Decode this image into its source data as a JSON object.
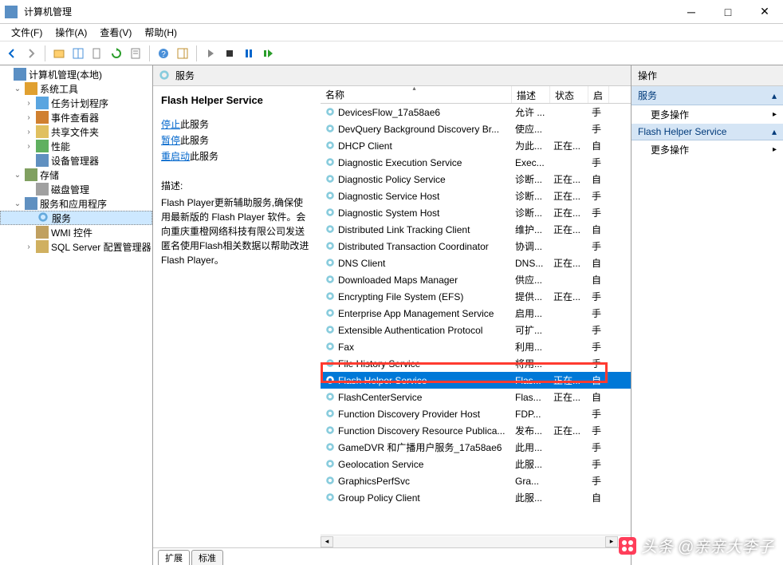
{
  "window": {
    "title": "计算机管理"
  },
  "menu": {
    "file": "文件(F)",
    "action": "操作(A)",
    "view": "查看(V)",
    "help": "帮助(H)"
  },
  "tree": {
    "root": "计算机管理(本地)",
    "sys_tools": "系统工具",
    "task_sched": "任务计划程序",
    "event_viewer": "事件查看器",
    "shared": "共享文件夹",
    "perf": "性能",
    "devmgr": "设备管理器",
    "storage": "存储",
    "diskmgr": "磁盘管理",
    "svc_apps": "服务和应用程序",
    "services": "服务",
    "wmi": "WMI 控件",
    "sql": "SQL Server 配置管理器"
  },
  "mid": {
    "header": "服务",
    "svc_name": "Flash Helper Service",
    "stop": "停止",
    "stop_suffix": "此服务",
    "pause": "暂停",
    "pause_suffix": "此服务",
    "restart": "重启动",
    "restart_suffix": "此服务",
    "desc_label": "描述:",
    "desc_text": "Flash Player更新辅助服务,确保使用最新版的 Flash Player 软件。会向重庆重橙网络科技有限公司发送匿名使用Flash相关数据以帮助改进 Flash Player。"
  },
  "cols": {
    "name": "名称",
    "desc": "描述",
    "status": "状态",
    "start": "启"
  },
  "rows": [
    {
      "name": "DevicesFlow_17a58ae6",
      "desc": "允许 ...",
      "status": "",
      "start": "手"
    },
    {
      "name": "DevQuery Background Discovery Br...",
      "desc": "使应...",
      "status": "",
      "start": "手"
    },
    {
      "name": "DHCP Client",
      "desc": "为此...",
      "status": "正在...",
      "start": "自"
    },
    {
      "name": "Diagnostic Execution Service",
      "desc": "Exec...",
      "status": "",
      "start": "手"
    },
    {
      "name": "Diagnostic Policy Service",
      "desc": "诊断...",
      "status": "正在...",
      "start": "自"
    },
    {
      "name": "Diagnostic Service Host",
      "desc": "诊断...",
      "status": "正在...",
      "start": "手"
    },
    {
      "name": "Diagnostic System Host",
      "desc": "诊断...",
      "status": "正在...",
      "start": "手"
    },
    {
      "name": "Distributed Link Tracking Client",
      "desc": "维护...",
      "status": "正在...",
      "start": "自"
    },
    {
      "name": "Distributed Transaction Coordinator",
      "desc": "协调...",
      "status": "",
      "start": "手"
    },
    {
      "name": "DNS Client",
      "desc": "DNS...",
      "status": "正在...",
      "start": "自"
    },
    {
      "name": "Downloaded Maps Manager",
      "desc": "供应...",
      "status": "",
      "start": "自"
    },
    {
      "name": "Encrypting File System (EFS)",
      "desc": "提供...",
      "status": "正在...",
      "start": "手"
    },
    {
      "name": "Enterprise App Management Service",
      "desc": "启用...",
      "status": "",
      "start": "手"
    },
    {
      "name": "Extensible Authentication Protocol",
      "desc": "可扩...",
      "status": "",
      "start": "手"
    },
    {
      "name": "Fax",
      "desc": "利用...",
      "status": "",
      "start": "手"
    },
    {
      "name": "File History Service",
      "desc": "将用...",
      "status": "",
      "start": "手"
    },
    {
      "name": "Flash Helper Service",
      "desc": "Flas...",
      "status": "正在...",
      "start": "自",
      "selected": true
    },
    {
      "name": "FlashCenterService",
      "desc": "Flas...",
      "status": "正在...",
      "start": "自"
    },
    {
      "name": "Function Discovery Provider Host",
      "desc": "FDP...",
      "status": "",
      "start": "手"
    },
    {
      "name": "Function Discovery Resource Publica...",
      "desc": "发布...",
      "status": "正在...",
      "start": "手"
    },
    {
      "name": "GameDVR 和广播用户服务_17a58ae6",
      "desc": "此用...",
      "status": "",
      "start": "手"
    },
    {
      "name": "Geolocation Service",
      "desc": "此服...",
      "status": "",
      "start": "手"
    },
    {
      "name": "GraphicsPerfSvc",
      "desc": "Gra...",
      "status": "",
      "start": "手"
    },
    {
      "name": "Group Policy Client",
      "desc": "此服...",
      "status": "",
      "start": "自"
    }
  ],
  "tabs": {
    "extended": "扩展",
    "standard": "标准"
  },
  "actions": {
    "title": "操作",
    "services": "服务",
    "more": "更多操作",
    "selected": "Flash Helper Service"
  },
  "watermark": "头条 @亲亲大李子"
}
